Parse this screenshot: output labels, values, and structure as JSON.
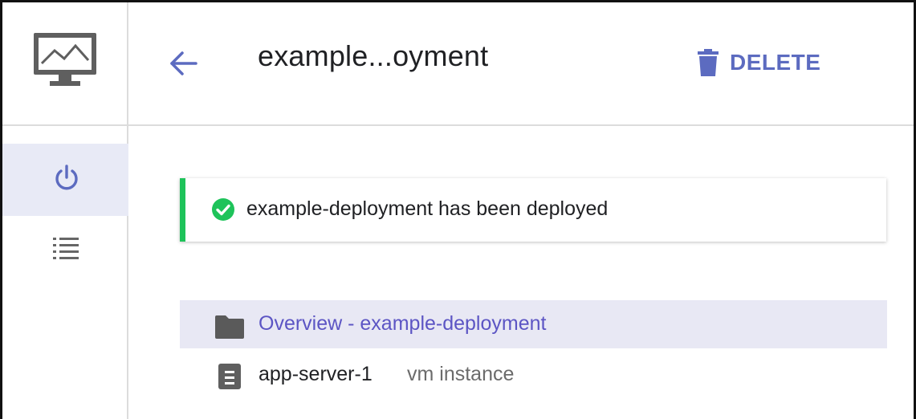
{
  "header": {
    "title": "example...oyment",
    "delete_label": "DELETE"
  },
  "notification": {
    "message": "example-deployment has been deployed",
    "status": "success",
    "accent_color": "#1ec35a"
  },
  "rail": {
    "items": [
      {
        "icon": "power-icon",
        "active": true
      },
      {
        "icon": "list-icon",
        "active": false
      }
    ]
  },
  "tree": {
    "overview_label": "Overview - example-deployment",
    "resources": [
      {
        "name": "app-server-1",
        "type": "vm instance",
        "icon": "server-icon"
      }
    ]
  },
  "colors": {
    "accent": "#5c6bc0",
    "selected_bg": "#e8e8f4",
    "success": "#1ec35a"
  }
}
